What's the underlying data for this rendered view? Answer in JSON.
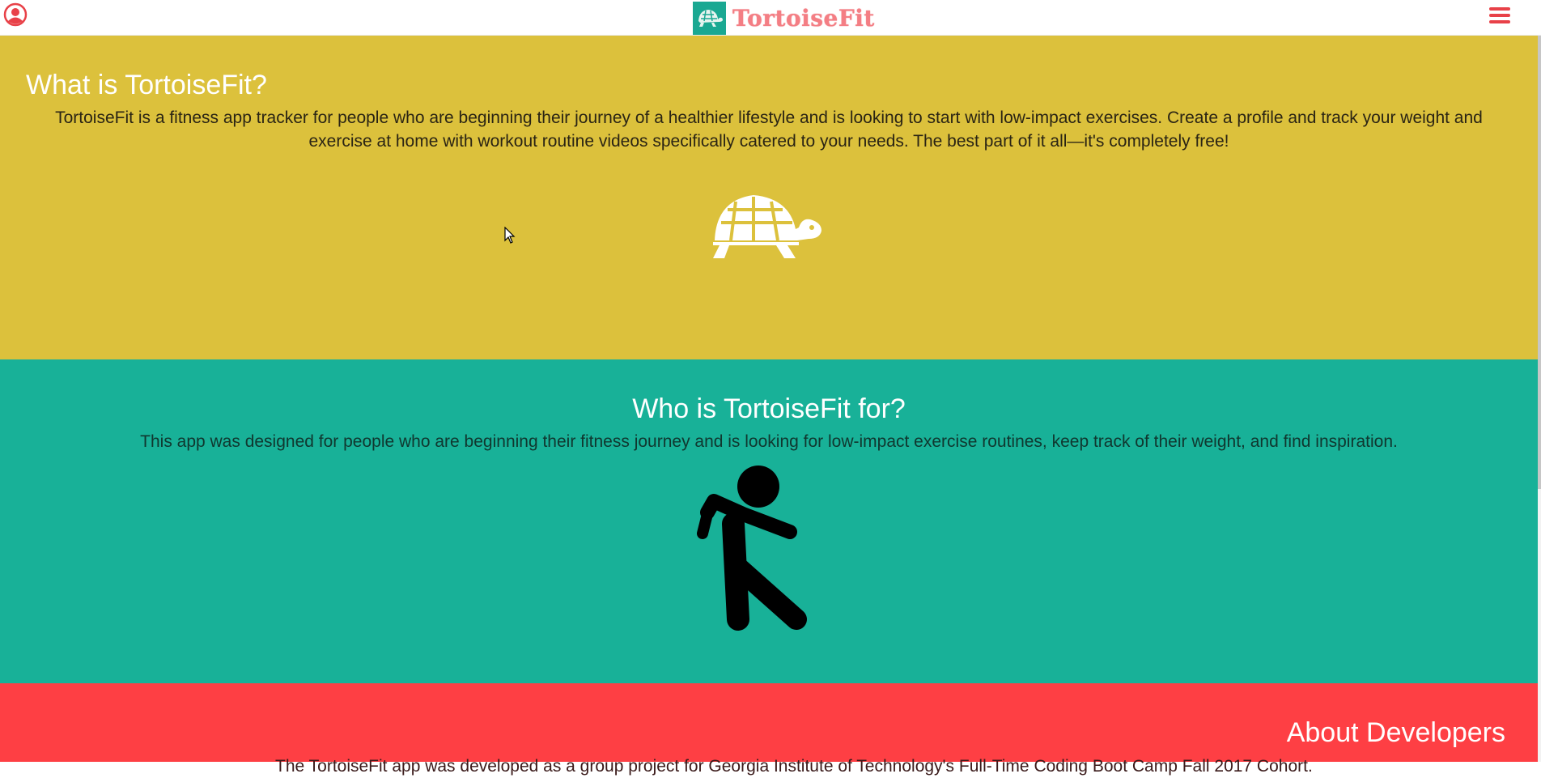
{
  "navbar": {
    "user_icon": "user-circle-icon",
    "brand_name": "TortoiseFit",
    "brand_logo": "turtle-logo-icon",
    "menu_icon": "hamburger-menu-icon"
  },
  "sections": {
    "what": {
      "title": "What is TortoiseFit?",
      "text": "TortoiseFit is a fitness app tracker for people who are beginning their journey of a healthier lifestyle and is looking to start with low-impact exercises. Create a profile and track your weight and exercise at home with workout routine videos specifically catered to your needs. The best part of it all—it's completely free!",
      "image_icon": "turtle-icon",
      "background": "#dcc13c"
    },
    "who": {
      "title": "Who is TortoiseFit for?",
      "text": "This app was designed for people who are beginning their fitness journey and is looking for low-impact exercise routines, keep track of their weight, and find inspiration.",
      "image_icon": "walking-person-icon",
      "background": "#18b198"
    },
    "developers": {
      "title": "About Developers",
      "text": "The TortoiseFit app was developed as a group project for Georgia Institute of Technology's Full-Time Coding Boot Camp Fall 2017 Cohort.",
      "background": "#fe3f44"
    }
  },
  "colors": {
    "accent": "#e84148",
    "brand_text": "#f47e84",
    "logo_bg": "#1aa892"
  }
}
